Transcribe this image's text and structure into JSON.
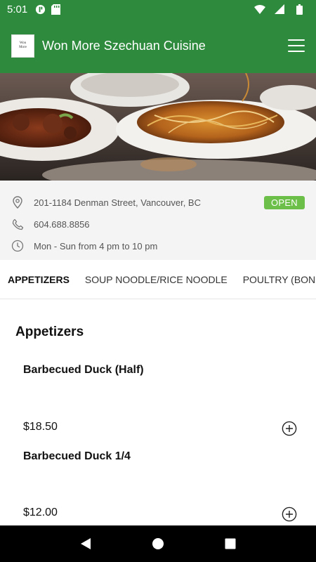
{
  "status_bar": {
    "time": "5:01",
    "icons": [
      "app-icon",
      "sd-card-icon",
      "wifi-icon",
      "signal-icon",
      "battery-icon"
    ]
  },
  "app_bar": {
    "logo_line1": "Won",
    "logo_line2": "More",
    "title": "Won More Szechuan Cuisine",
    "menu_icon": "hamburger-menu-icon",
    "color": "#2e8b3e"
  },
  "info": {
    "address": "201-1184 Denman Street, Vancouver, BC",
    "phone": "604.688.8856",
    "hours": "Mon - Sun from 4 pm to 10 pm",
    "status": "OPEN",
    "status_color": "#6cc04a"
  },
  "tabs": [
    {
      "label": "APPETIZERS",
      "active": true
    },
    {
      "label": "SOUP NOODLE/RICE NOODLE",
      "active": false
    },
    {
      "label": "POULTRY (BON",
      "active": false
    }
  ],
  "menu": {
    "section_title": "Appetizers",
    "items": [
      {
        "name": "Barbecued Duck (Half)",
        "price": "$18.50"
      },
      {
        "name": "Barbecued Duck 1/4",
        "price": "$12.00"
      }
    ]
  },
  "nav_bar": {
    "icons": [
      "back-icon",
      "home-icon",
      "recents-icon"
    ]
  }
}
